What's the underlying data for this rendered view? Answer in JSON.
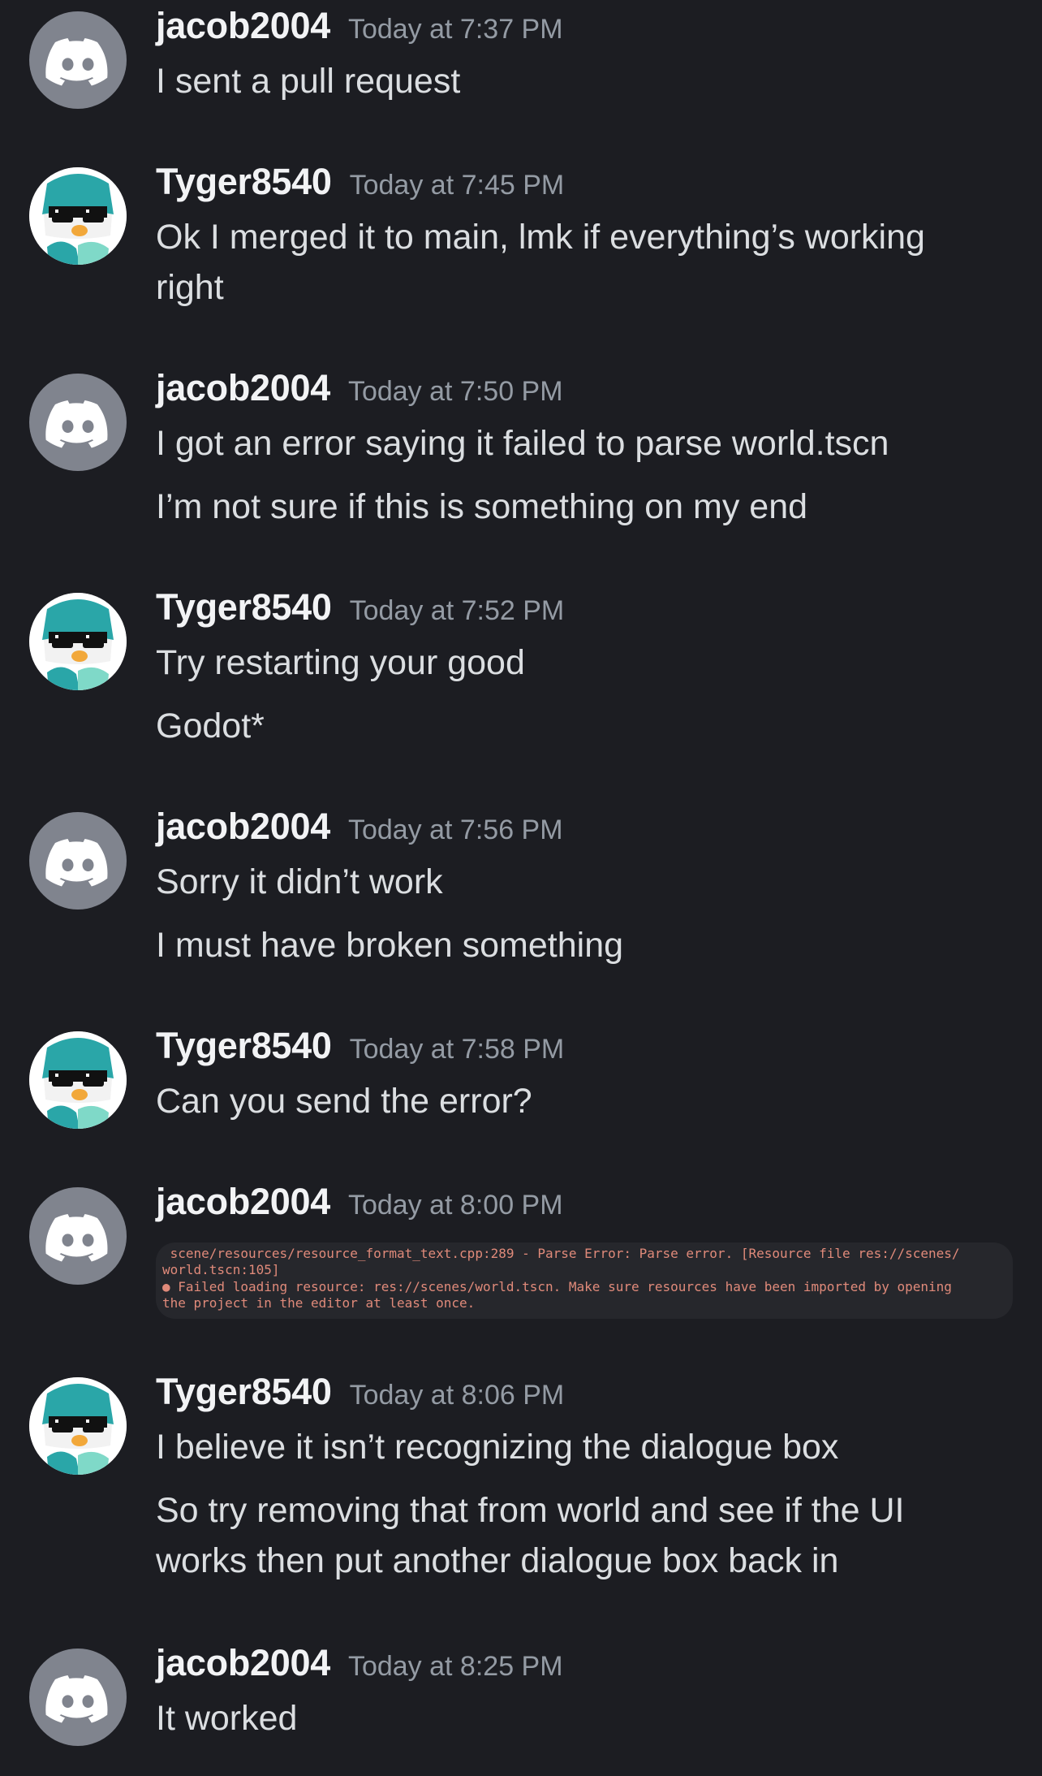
{
  "messages": [
    {
      "user": "jacob2004",
      "time": "Today at 7:37 PM",
      "lines": [
        "I sent a pull request"
      ]
    },
    {
      "user": "Tyger8540",
      "time": "Today at 7:45 PM",
      "lines": [
        "Ok I merged it to main, lmk if everything’s working",
        "right"
      ]
    },
    {
      "user": "jacob2004",
      "time": "Today at 7:50 PM",
      "lines": [
        "I got an error saying it failed to parse world.tscn",
        "I’m not sure if this is something on my end"
      ]
    },
    {
      "user": "Tyger8540",
      "time": "Today at 7:52 PM",
      "lines": [
        "Try restarting your good",
        "Godot*"
      ]
    },
    {
      "user": "jacob2004",
      "time": "Today at 7:56 PM",
      "lines": [
        "Sorry it didn’t work",
        "I must have broken something"
      ]
    },
    {
      "user": "Tyger8540",
      "time": "Today at 7:58 PM",
      "lines": [
        "Can you send the error?"
      ]
    },
    {
      "user": "jacob2004",
      "time": "Today at 8:00 PM",
      "error_lines": [
        " scene/resources/resource_format_text.cpp:289 - Parse Error: Parse error. [Resource file res://scenes/",
        "world.tscn:105]",
        "● Failed loading resource: res://scenes/world.tscn. Make sure resources have been imported by opening",
        "the project in the editor at least once."
      ]
    },
    {
      "user": "Tyger8540",
      "time": "Today at 8:06 PM",
      "lines": [
        "I believe it isn’t recognizing the dialogue box",
        "So try removing that from world and see if the UI",
        "works then put another dialogue box back in"
      ]
    },
    {
      "user": "jacob2004",
      "time": "Today at 8:25 PM",
      "lines": [
        "It worked"
      ]
    }
  ],
  "colors": {
    "background": "#1c1d22",
    "username": "#f2f3f5",
    "timestamp": "#949ba4",
    "message_text": "#dbdee1",
    "discord_avatar": "#80848e",
    "error_text": "#e08a7a"
  },
  "icons": {
    "jacob2004_avatar": "discord-logo-icon",
    "Tyger8540_avatar": "penguin-sunglasses-icon"
  }
}
